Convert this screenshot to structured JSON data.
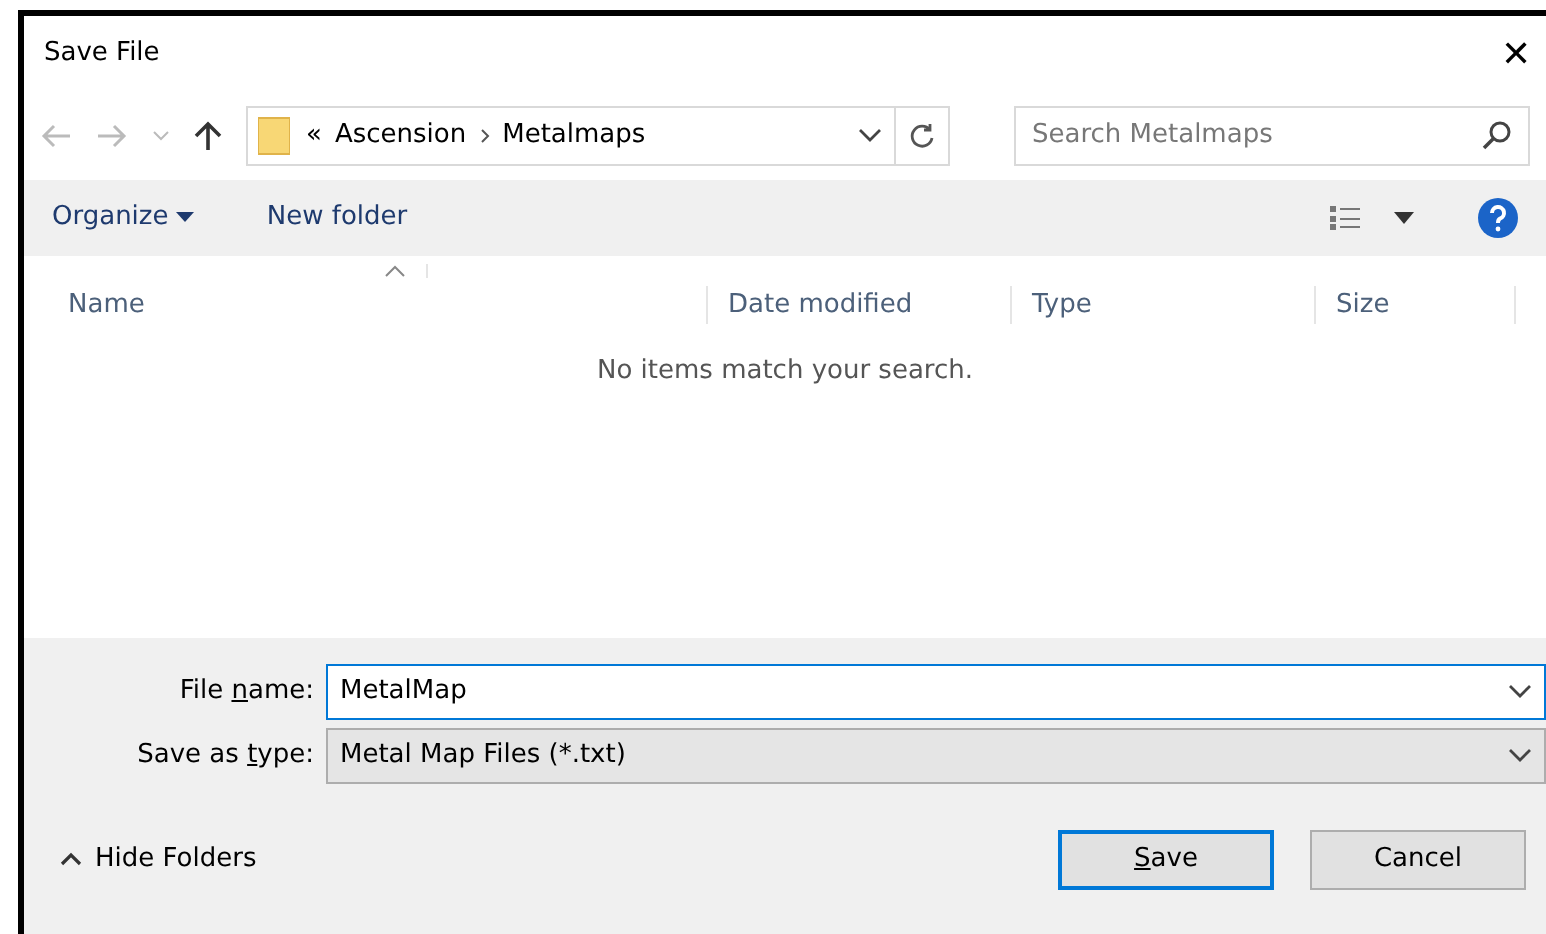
{
  "window": {
    "title": "Save File",
    "close": "✕"
  },
  "navigation": {
    "path": [
      "Ascension",
      "Metalmaps"
    ],
    "overflow": "«",
    "search": {
      "placeholder": "Search Metalmaps"
    }
  },
  "toolbar": {
    "organize": "Organize",
    "new_folder": "New folder"
  },
  "columns": [
    {
      "label": "Name"
    },
    {
      "label": "Date modified"
    },
    {
      "label": "Type"
    },
    {
      "label": "Size"
    }
  ],
  "empty_message": "No items match your search.",
  "fields": [
    {
      "kind": "edit",
      "label": {
        "before": "File ",
        "key": "n",
        "after": "ame:"
      },
      "value": "MetalMap"
    },
    {
      "kind": "combo",
      "label": {
        "before": "Save as ",
        "key": "t",
        "after": "ype:"
      },
      "value": "Metal Map Files (*.txt)"
    }
  ],
  "hide_folders": "Hide Folders",
  "buttons": [
    {
      "label": {
        "key": "S",
        "after": "ave"
      },
      "default": true
    },
    {
      "label": {
        "before": "Cancel"
      },
      "default": false
    }
  ]
}
